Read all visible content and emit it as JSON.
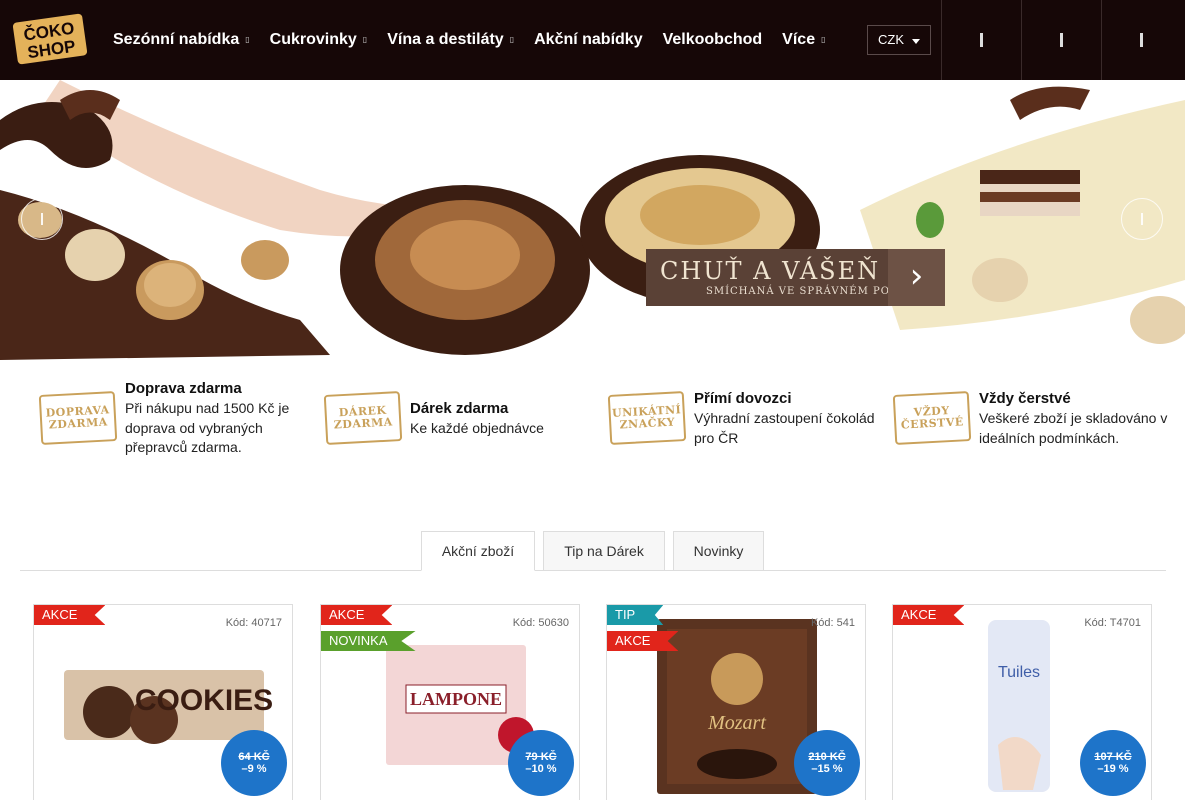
{
  "header": {
    "logo_top": "ČOKO",
    "logo_bottom": "SHOP",
    "nav": [
      {
        "label": "Sezónní nabídka",
        "has_dropdown": true
      },
      {
        "label": "Cukrovinky",
        "has_dropdown": true
      },
      {
        "label": "Vína a destiláty",
        "has_dropdown": true
      },
      {
        "label": "Akční nabídky",
        "has_dropdown": false
      },
      {
        "label": "Velkoobchod",
        "has_dropdown": false
      },
      {
        "label": "Více",
        "has_dropdown": true
      }
    ],
    "currency": "CZK",
    "icons": [
      "search-icon",
      "user-icon",
      "cart-icon"
    ]
  },
  "banner": {
    "headline": "CHUŤ A VÁŠEŇ",
    "subline": "SMÍCHANÁ VE SPRÁVNÉM POMĚRU",
    "cta_arrow": "›"
  },
  "benefits": [
    {
      "stamp": "DOPRAVA ZDARMA",
      "title": "Doprava zdarma",
      "text": "Při nákupu nad 1500 Kč je doprava od vybraných přepravců zdarma."
    },
    {
      "stamp": "DÁREK ZDARMA",
      "title": "Dárek zdarma",
      "text": "Ke každé objednávce"
    },
    {
      "stamp": "UNIKÁTNÍ ZNAČKY",
      "title": "Přímí dovozci",
      "text": "Výhradní zastoupení čokolád pro ČR"
    },
    {
      "stamp": "VŽDY ČERSTVÉ",
      "title": "Vždy čerstvé",
      "text": "Veškeré zboží je skladováno v ideálních podmínkách."
    }
  ],
  "tabs": [
    "Akční zboží",
    "Tip na Dárek",
    "Novinky"
  ],
  "products": [
    {
      "badges": [
        "AKCE"
      ],
      "code": "Kód: 40717",
      "old_price": "64 KČ",
      "discount": "–9 %",
      "image_text": "COOKIES",
      "colors": {
        "box": "#d9c2a8",
        "accent": "#4a2a1a"
      }
    },
    {
      "badges": [
        "AKCE",
        "NOVINKA"
      ],
      "code": "Kód: 50630",
      "old_price": "79 KČ",
      "discount": "–10 %",
      "image_text": "LAMPONE",
      "colors": {
        "box": "#f3d6d6",
        "accent": "#8a1f2a"
      }
    },
    {
      "badges": [
        "TIP",
        "AKCE"
      ],
      "code": "Kód: 541",
      "old_price": "210 KČ",
      "discount": "–15 %",
      "image_text": "Mozart",
      "colors": {
        "box": "#5a3320",
        "accent": "#c89a5a"
      }
    },
    {
      "badges": [
        "AKCE"
      ],
      "code": "Kód: T4701",
      "old_price": "107 KČ",
      "discount": "–19 %",
      "image_text": "Tuiles",
      "colors": {
        "box": "#e3e8f5",
        "accent": "#3f5ea8"
      }
    }
  ]
}
